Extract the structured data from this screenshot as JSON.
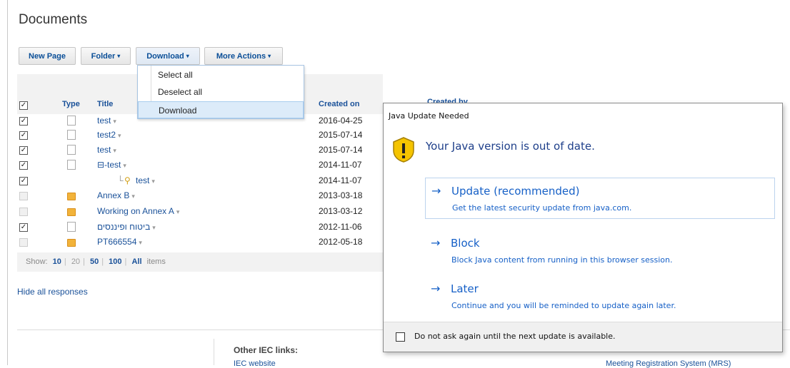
{
  "page": {
    "title": "Documents"
  },
  "toolbar": {
    "new_page": "New Page",
    "folder": "Folder",
    "download": "Download",
    "more_actions": "More Actions",
    "caret": "▾"
  },
  "download_menu": {
    "items": [
      "Select all",
      "Deselect all",
      "Download"
    ]
  },
  "grid": {
    "columns": {
      "type": "Type",
      "title": "Title",
      "created_on": "Created on",
      "created_by": "Created by"
    },
    "rows": [
      {
        "checked": true,
        "type": "doc",
        "title": "test",
        "created_on": "2016-04-25"
      },
      {
        "checked": true,
        "type": "doc",
        "title": "test2",
        "created_on": "2015-07-14"
      },
      {
        "checked": true,
        "type": "doc",
        "title": "test",
        "created_on": "2015-07-14"
      },
      {
        "checked": true,
        "type": "doc",
        "title": "⊟-test",
        "created_on": "2014-11-07"
      },
      {
        "checked": true,
        "type": "response",
        "title": "test",
        "created_on": "2014-11-07"
      },
      {
        "checked": false,
        "type": "folder",
        "title": "Annex B",
        "created_on": "2013-03-18"
      },
      {
        "checked": false,
        "type": "folder",
        "title": "Working on Annex A",
        "created_on": "2013-03-12"
      },
      {
        "checked": true,
        "type": "doc",
        "title": "ביטוח ופיננסים",
        "created_on": "2012-11-06"
      },
      {
        "checked": false,
        "type": "folder",
        "title": "PT666554",
        "created_on": "2012-05-18"
      }
    ]
  },
  "show_bar": {
    "label": "Show:",
    "options": [
      "10",
      "20",
      "50",
      "100",
      "All"
    ],
    "suffix": "items"
  },
  "hide_responses": "Hide all responses",
  "footer": {
    "other_links_title": "Other IEC links:",
    "iec_website": "IEC website",
    "mrs": "Meeting Registration System (MRS)"
  },
  "java_dialog": {
    "title": "Java Update Needed",
    "heading": "Your Java version is out of date.",
    "options": [
      {
        "arrow": "→",
        "label": "Update (recommended)",
        "desc": "Get the latest security update from java.com."
      },
      {
        "arrow": "→",
        "label": "Block",
        "desc": "Block Java content from running in this browser session."
      },
      {
        "arrow": "→",
        "label": "Later",
        "desc": "Continue and you will be reminded to update again later."
      }
    ],
    "checkbox_label": "Do not ask again until the next update is available."
  },
  "colors": {
    "link": "#1a5199",
    "dialog_link": "#1660c7",
    "folder": "#f2b33a"
  },
  "icons": {
    "warning": "warning-shield-icon",
    "doc": "document-icon",
    "folder": "folder-icon",
    "response": "response-person-icon"
  }
}
